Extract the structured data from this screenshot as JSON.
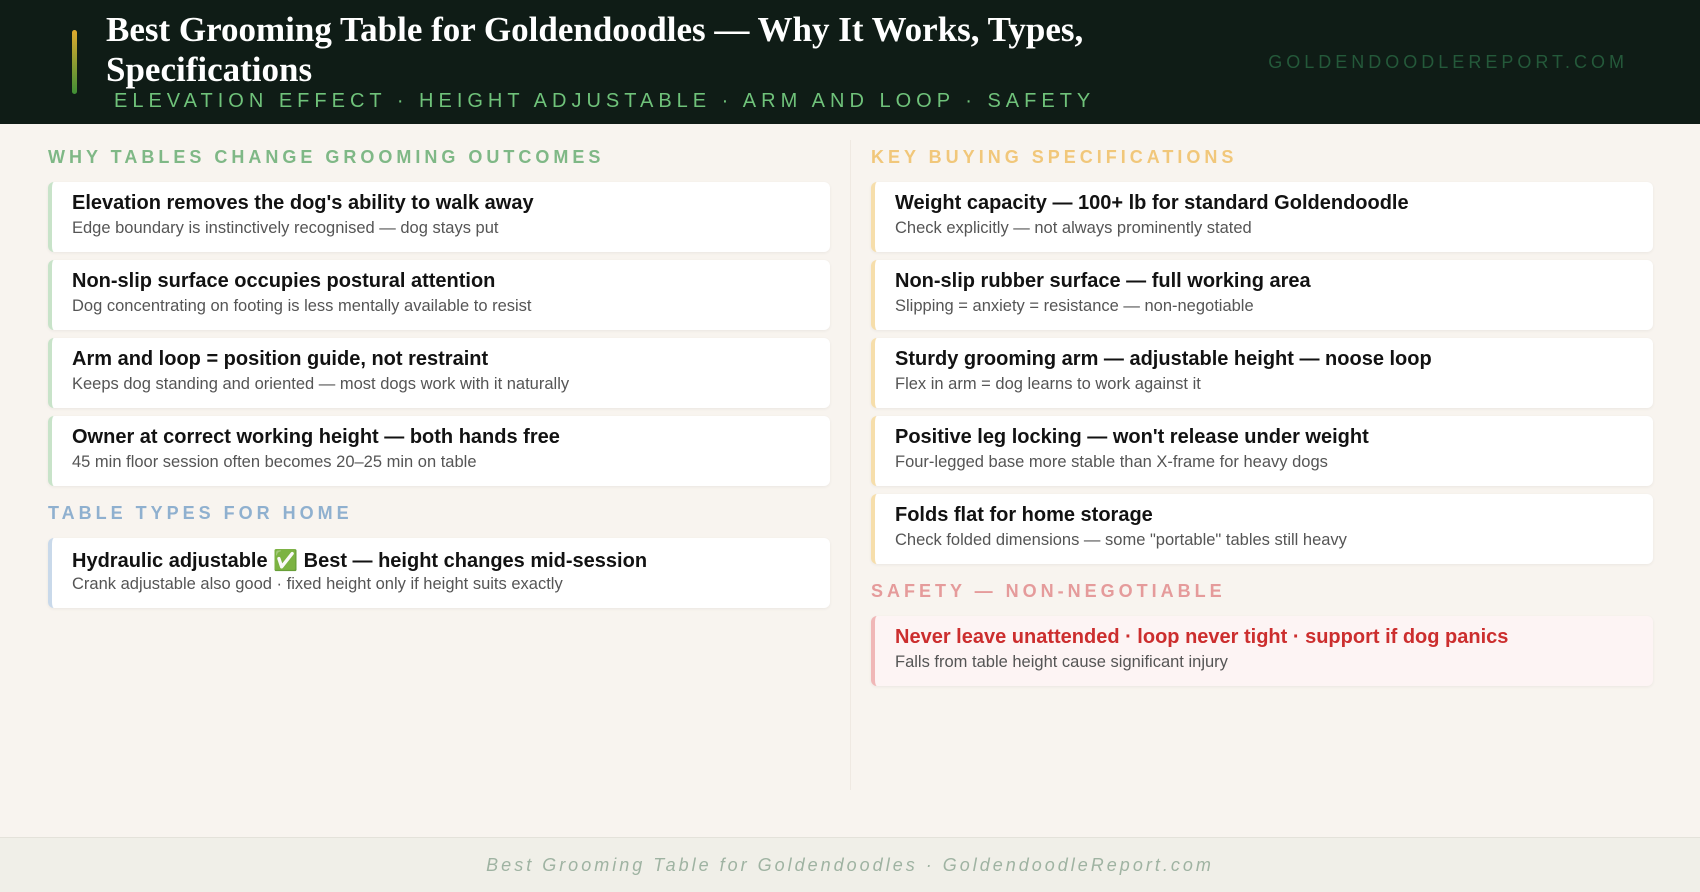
{
  "header": {
    "title": "Best Grooming Table for Goldendoodles — Why It Works, Types, Specifications",
    "subtitle": "ELEVATION EFFECT · HEIGHT ADJUSTABLE · ARM AND LOOP · SAFETY",
    "site": "GOLDENDOODLEREPORT.COM",
    "accent_colors": [
      "#e0a92e",
      "#3f8f35"
    ]
  },
  "left": {
    "why": {
      "heading": "WHY TABLES CHANGE GROOMING OUTCOMES",
      "color": "#7fb886",
      "items": [
        {
          "title": "Elevation removes the dog's ability to walk away",
          "detail": "Edge boundary is instinctively recognised — dog stays put"
        },
        {
          "title": "Non-slip surface occupies postural attention",
          "detail": "Dog concentrating on footing is less mentally available to resist"
        },
        {
          "title": "Arm and loop = position guide, not restraint",
          "detail": "Keeps dog standing and oriented — most dogs work with it naturally"
        },
        {
          "title": "Owner at correct working height — both hands free",
          "detail": "45 min floor session often becomes 20–25 min on table"
        }
      ]
    },
    "types": {
      "heading": "TABLE TYPES FOR HOME",
      "color": "#8fb0cf",
      "items": [
        {
          "title": "Hydraulic adjustable ✅ Best — height changes mid-session",
          "detail": "Crank adjustable also good · fixed height only if height suits exactly"
        }
      ]
    }
  },
  "right": {
    "specs": {
      "heading": "KEY BUYING SPECIFICATIONS",
      "color": "#f1c77a",
      "items": [
        {
          "title": "Weight capacity — 100+ lb for standard Goldendoodle",
          "detail": "Check explicitly — not always prominently stated"
        },
        {
          "title": "Non-slip rubber surface — full working area",
          "detail": "Slipping = anxiety = resistance — non-negotiable"
        },
        {
          "title": "Sturdy grooming arm — adjustable height — noose loop",
          "detail": "Flex in arm = dog learns to work against it"
        },
        {
          "title": "Positive leg locking — won't release under weight",
          "detail": "Four-legged base more stable than X-frame for heavy dogs"
        },
        {
          "title": "Folds flat for home storage",
          "detail": "Check folded dimensions — some \"portable\" tables still heavy"
        }
      ]
    },
    "safety": {
      "heading": "SAFETY — NON-NEGOTIABLE",
      "color": "#e59b9b",
      "items": [
        {
          "title": "Never leave unattended · loop never tight · support if dog panics",
          "detail": "Falls from table height cause significant injury"
        }
      ]
    }
  },
  "footer": {
    "text": "Best Grooming Table for Goldendoodles · GoldendoodleReport.com"
  }
}
